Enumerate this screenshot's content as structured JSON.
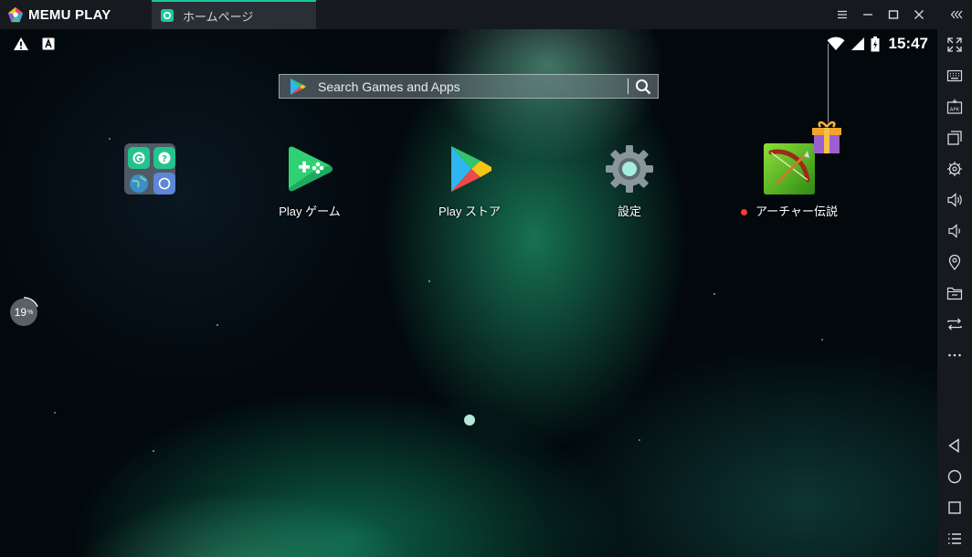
{
  "titlebar": {
    "logo_text": "MEMU PLAY",
    "tab_label": "ホームページ",
    "controls": [
      "menu-icon",
      "minimize-icon",
      "maximize-icon",
      "close-icon",
      "expand-sidebar-icon"
    ]
  },
  "status_bar": {
    "time": "15:47",
    "left_icons": [
      "warning-icon",
      "a-notification-icon"
    ],
    "right_icons": [
      "wifi-icon",
      "signal-icon",
      "battery-icon"
    ]
  },
  "search": {
    "placeholder": "Search Games and Apps"
  },
  "apps": [
    {
      "label": ""
    },
    {
      "label": "Play ゲーム"
    },
    {
      "label": "Play ストア"
    },
    {
      "label": "設定"
    },
    {
      "label": "アーチャー伝説",
      "has_update_dot": true
    }
  ],
  "progress": {
    "value": "19",
    "unit": "%",
    "fraction": 0.19
  },
  "sidebar": {
    "top_items": [
      "fullscreen-icon",
      "keyboard-icon",
      "apk-icon",
      "multi-window-icon",
      "settings-icon",
      "volume-up-icon",
      "volume-down-icon",
      "location-icon",
      "folder-icon",
      "rotate-icon",
      "more-icon"
    ],
    "bottom_items": [
      "back-icon",
      "home-icon",
      "recents-icon",
      "list-icon"
    ]
  },
  "colors": {
    "accent": "#19c6a0",
    "titlebar_bg": "#16191d",
    "tab_bg": "#2a2f35",
    "update_dot": "#ff3b30"
  }
}
